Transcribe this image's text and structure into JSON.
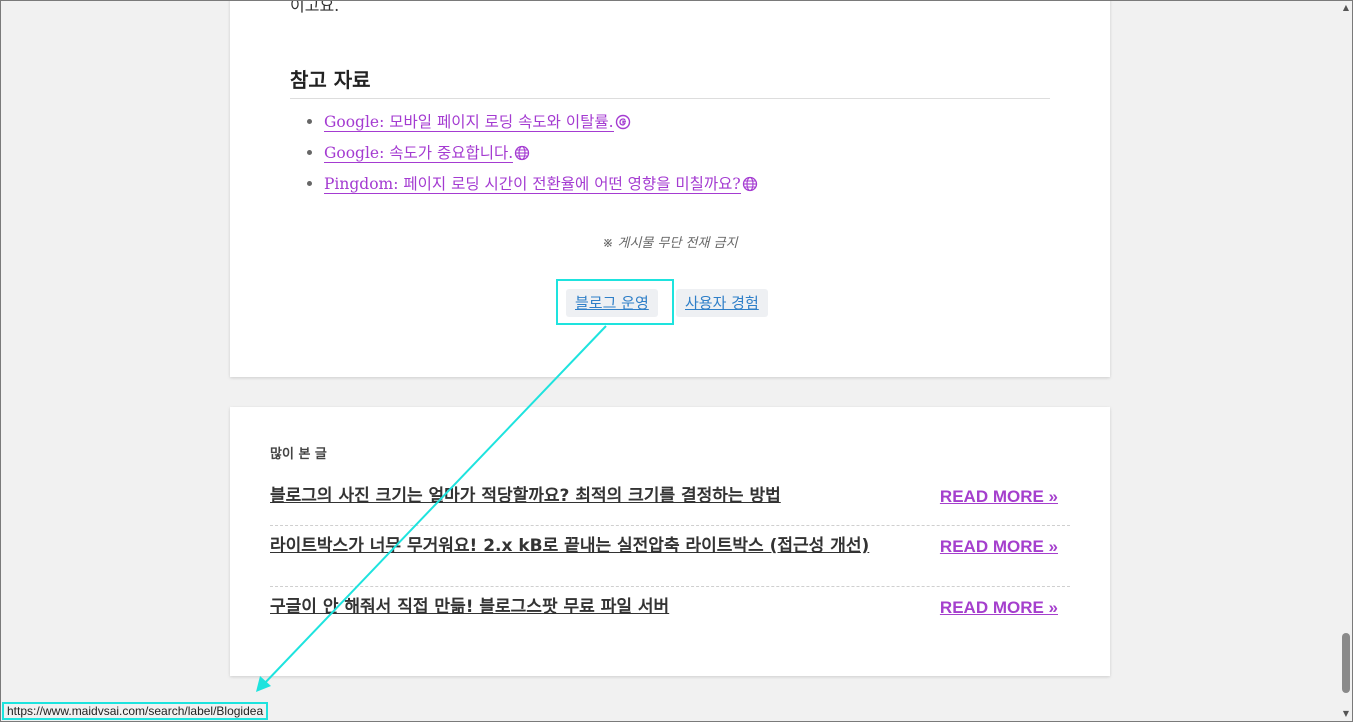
{
  "article": {
    "cut_off_text": "이고요.",
    "references_heading": "참고 자료",
    "references": [
      {
        "label": "Google: 모바일 페이지 로딩 속도와 이탈률.",
        "icon": "google-icon"
      },
      {
        "label": "Google: 속도가 중요합니다.",
        "icon": "globe-icon"
      },
      {
        "label": "Pingdom: 페이지 로딩 시간이 전환율에 어떤 영향을 미칠까요?",
        "icon": "globe-icon"
      }
    ],
    "copyright_notice": "※ 게시물 무단 전재 금지",
    "tags": [
      "블로그 운영",
      "사용자 경험"
    ]
  },
  "popular_posts": {
    "title": "많이 본 글",
    "items": [
      {
        "title": "블로그의 사진 크기는 얼마가 적당할까요? 최적의 크기를 결정하는 방법",
        "action": "READ MORE »"
      },
      {
        "title": "라이트박스가 너무 무거워요! 2.x kB로 끝내는 실전압축 라이트박스 (접근성 개선)",
        "action": "READ MORE »"
      },
      {
        "title": "구글이 안 해줘서 직접 만듦! 블로그스팟 무료 파일 서버",
        "action": "READ MORE »"
      }
    ]
  },
  "status_bar": {
    "url": "https://www.maidvsai.com/search/label/Blogidea"
  },
  "colors": {
    "link": "#a43bd1",
    "tag_text": "#2f7fc8",
    "read_more": "#a53fcd",
    "annotation": "#1ee3de"
  }
}
